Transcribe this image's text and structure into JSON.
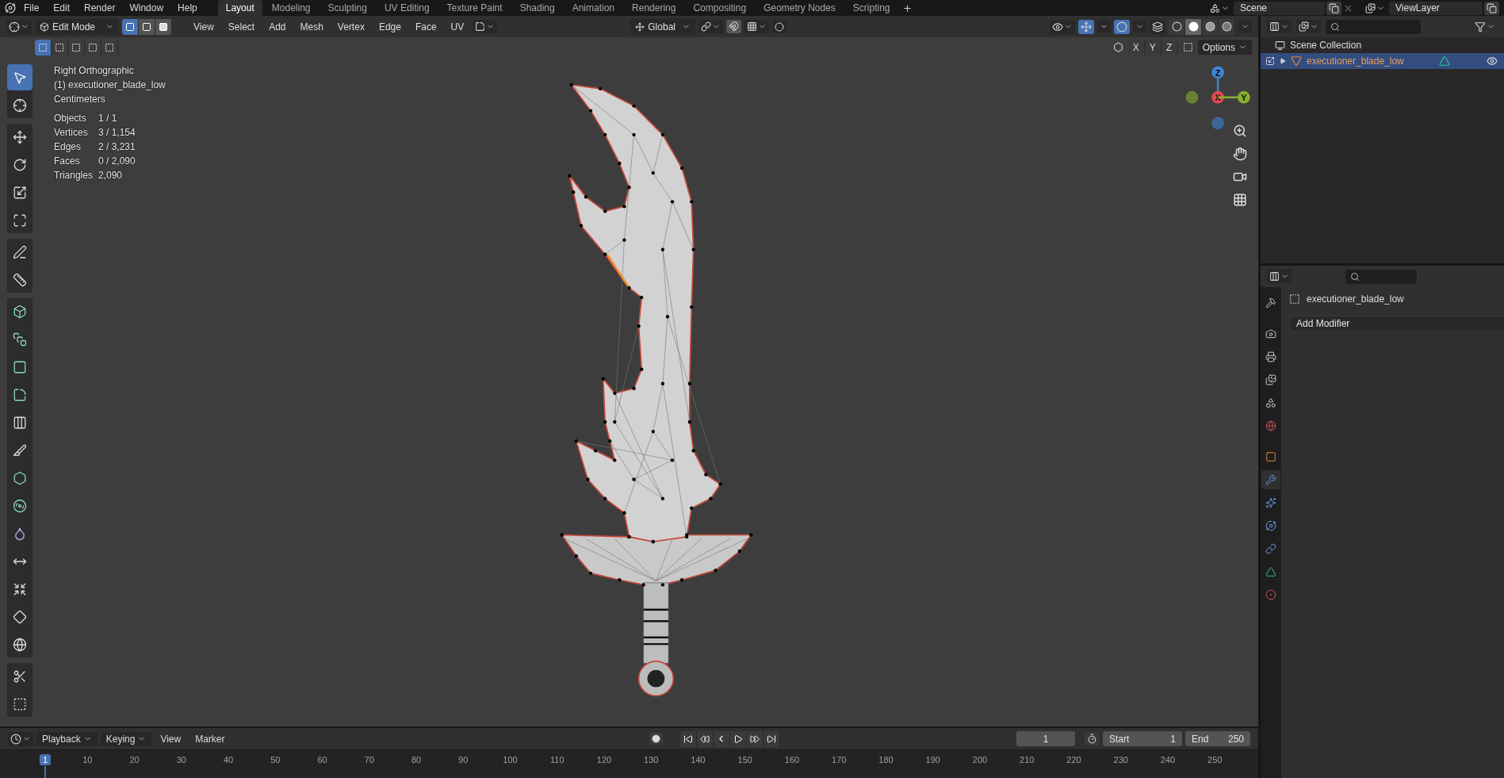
{
  "menu": [
    "File",
    "Edit",
    "Render",
    "Window",
    "Help"
  ],
  "workspaces": [
    {
      "label": "Layout",
      "selected": true
    },
    {
      "label": "Modeling",
      "selected": false
    },
    {
      "label": "Sculpting",
      "selected": false
    },
    {
      "label": "UV Editing",
      "selected": false
    },
    {
      "label": "Texture Paint",
      "selected": false
    },
    {
      "label": "Shading",
      "selected": false
    },
    {
      "label": "Animation",
      "selected": false
    },
    {
      "label": "Rendering",
      "selected": false
    },
    {
      "label": "Compositing",
      "selected": false
    },
    {
      "label": "Geometry Nodes",
      "selected": false
    },
    {
      "label": "Scripting",
      "selected": false
    }
  ],
  "scene": "Scene",
  "view_layer": "ViewLayer",
  "viewport_header": {
    "mode": "Edit Mode",
    "select_modes": [
      {
        "kind": "vertex",
        "selected": true
      },
      {
        "kind": "edge",
        "selected": false
      },
      {
        "kind": "face",
        "selected": false
      }
    ],
    "menus": [
      "View",
      "Select",
      "Add",
      "Mesh",
      "Vertex",
      "Edge",
      "Face",
      "UV"
    ],
    "orientation": "Global",
    "shading": [
      {
        "kind": "wireframe",
        "selected": false
      },
      {
        "kind": "solid",
        "selected": true
      },
      {
        "kind": "material",
        "selected": false
      },
      {
        "kind": "rendered",
        "selected": false
      }
    ],
    "mirror_axes": [
      "X",
      "Y",
      "Z"
    ],
    "options": "Options"
  },
  "overlay": {
    "view": "Right Orthographic",
    "object": "(1) executioner_blade_low",
    "units": "Centimeters",
    "stats": [
      {
        "label": "Objects",
        "value": "1 / 1"
      },
      {
        "label": "Vertices",
        "value": "3 / 1,154"
      },
      {
        "label": "Edges",
        "value": "2 / 3,231"
      },
      {
        "label": "Faces",
        "value": "0 / 2,090"
      },
      {
        "label": "Triangles",
        "value": "2,090"
      }
    ]
  },
  "tool_groups": [
    {
      "tools": [
        {
          "kind": "select",
          "selected": true
        },
        {
          "kind": "cursor",
          "selected": false
        }
      ]
    },
    {
      "tools": [
        {
          "kind": "move",
          "selected": false
        },
        {
          "kind": "rotate",
          "selected": false
        },
        {
          "kind": "scale",
          "selected": false
        },
        {
          "kind": "transform",
          "selected": false
        }
      ]
    },
    {
      "tools": [
        {
          "kind": "annotate",
          "selected": false
        },
        {
          "kind": "measure",
          "selected": false
        }
      ]
    },
    {
      "tools": [
        {
          "kind": "add-cube",
          "selected": false
        },
        {
          "kind": "extrude",
          "selected": false
        },
        {
          "kind": "inset",
          "selected": false
        },
        {
          "kind": "bevel",
          "selected": false
        },
        {
          "kind": "loop-cut",
          "selected": false
        },
        {
          "kind": "knife",
          "selected": false
        },
        {
          "kind": "poly-build",
          "selected": false
        },
        {
          "kind": "spin",
          "selected": false
        },
        {
          "kind": "smooth",
          "selected": false
        },
        {
          "kind": "edge-slide",
          "selected": false
        },
        {
          "kind": "shrink-fatten",
          "selected": false
        },
        {
          "kind": "shear",
          "selected": false
        },
        {
          "kind": "to-sphere",
          "selected": false
        }
      ]
    },
    {
      "tools": [
        {
          "kind": "rip",
          "selected": false
        },
        {
          "kind": "rip-edge",
          "selected": false
        }
      ]
    }
  ],
  "gizmo": {
    "axes": [
      {
        "label": "Z",
        "color": "#3c85d6"
      },
      {
        "label": "X",
        "color": "#e04a56"
      },
      {
        "label": "Y",
        "color": "#86b02c"
      }
    ]
  },
  "outliner": {
    "root": "Scene Collection",
    "items": [
      {
        "label": "executioner_blade_low",
        "selected": true,
        "visible": true
      }
    ]
  },
  "properties": {
    "tabs": [
      {
        "kind": "tool",
        "selected": false
      },
      {
        "kind": "render",
        "selected": false
      },
      {
        "kind": "output",
        "selected": false
      },
      {
        "kind": "view-layer",
        "selected": false
      },
      {
        "kind": "scene",
        "selected": false
      },
      {
        "kind": "world",
        "selected": false
      },
      {
        "kind": "object",
        "selected": false
      },
      {
        "kind": "modifiers",
        "selected": true
      },
      {
        "kind": "particles",
        "selected": false
      },
      {
        "kind": "physics",
        "selected": false
      },
      {
        "kind": "constraints",
        "selected": false
      },
      {
        "kind": "data",
        "selected": false
      },
      {
        "kind": "material",
        "selected": false
      }
    ],
    "object": "executioner_blade_low",
    "add_modifier": "Add Modifier"
  },
  "timeline": {
    "menus": [
      "Playback",
      "Keying",
      "View",
      "Marker"
    ],
    "current_frame": "1",
    "start_label": "Start",
    "start": "1",
    "end_label": "End",
    "end": "250",
    "ruler": [
      {
        "label": "1",
        "selected": true
      },
      {
        "label": "10",
        "selected": false
      },
      {
        "label": "20",
        "selected": false
      },
      {
        "label": "30",
        "selected": false
      },
      {
        "label": "40",
        "selected": false
      },
      {
        "label": "50",
        "selected": false
      },
      {
        "label": "60",
        "selected": false
      },
      {
        "label": "70",
        "selected": false
      },
      {
        "label": "80",
        "selected": false
      },
      {
        "label": "90",
        "selected": false
      },
      {
        "label": "100",
        "selected": false
      },
      {
        "label": "110",
        "selected": false
      },
      {
        "label": "120",
        "selected": false
      },
      {
        "label": "130",
        "selected": false
      },
      {
        "label": "140",
        "selected": false
      },
      {
        "label": "150",
        "selected": false
      },
      {
        "label": "160",
        "selected": false
      },
      {
        "label": "170",
        "selected": false
      },
      {
        "label": "180",
        "selected": false
      },
      {
        "label": "190",
        "selected": false
      },
      {
        "label": "200",
        "selected": false
      },
      {
        "label": "210",
        "selected": false
      },
      {
        "label": "220",
        "selected": false
      },
      {
        "label": "230",
        "selected": false
      },
      {
        "label": "240",
        "selected": false
      },
      {
        "label": "250",
        "selected": false
      }
    ]
  }
}
